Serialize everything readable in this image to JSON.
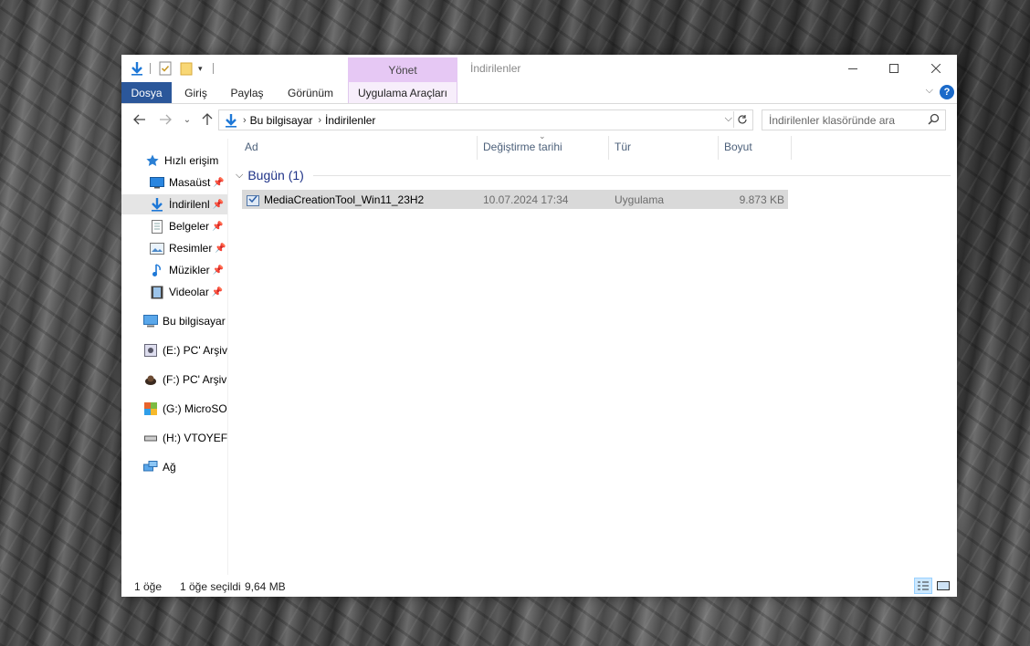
{
  "window": {
    "title": "İndirilenler",
    "context_tab_header": "Yönet"
  },
  "ribbon": {
    "tabs": [
      "Dosya",
      "Giriş",
      "Paylaş",
      "Görünüm",
      "Uygulama Araçları"
    ],
    "help": "?"
  },
  "address": {
    "crumbs": [
      "Bu bilgisayar",
      "İndirilenler"
    ]
  },
  "search": {
    "placeholder": "İndirilenler klasöründe ara"
  },
  "sidebar": {
    "quick_access": "Hızlı erişim",
    "items": [
      {
        "label": "Masaüst",
        "icon": "desktop-icon",
        "pinned": true
      },
      {
        "label": "İndirilenl",
        "icon": "download-arrow-icon",
        "pinned": true,
        "selected": true
      },
      {
        "label": "Belgeler",
        "icon": "document-icon",
        "pinned": true
      },
      {
        "label": "Resimler",
        "icon": "pictures-icon",
        "pinned": true
      },
      {
        "label": "Müzikler",
        "icon": "music-note-icon",
        "pinned": true
      },
      {
        "label": "Videolar",
        "icon": "film-icon",
        "pinned": true
      }
    ],
    "this_pc": "Bu bilgisayar",
    "drives": [
      {
        "label": "(E:) PC' Arşivi",
        "icon": "drive-e-icon"
      },
      {
        "label": "(F:) PC' Arşivi",
        "icon": "drive-f-icon"
      },
      {
        "label": "(G:) MicroSO",
        "icon": "drive-g-icon"
      },
      {
        "label": "(H:) VTOYEFI",
        "icon": "usb-drive-icon"
      }
    ],
    "network": "Ağ"
  },
  "columns": [
    "Ad",
    "Değiştirme tarihi",
    "Tür",
    "Boyut"
  ],
  "group": {
    "label": "Bugün (1)"
  },
  "files": [
    {
      "name": "MediaCreationTool_Win11_23H2",
      "modified": "10.07.2024 17:34",
      "type": "Uygulama",
      "size": "9.873 KB"
    }
  ],
  "status": {
    "count": "1 öğe",
    "selected": "1 öğe seçildi",
    "size": "9,64 MB"
  },
  "colors": {
    "file_tab": "#2b579a",
    "context_tab": "#e6c8f4",
    "selection": "#d9d9d9",
    "group_header": "#1e3287",
    "column_header": "#4c607a"
  }
}
